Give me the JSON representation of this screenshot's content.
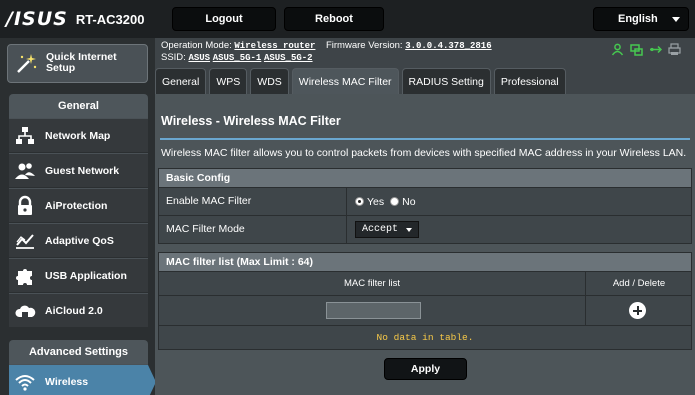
{
  "header": {
    "brand": "/ISUS",
    "model": "RT-AC3200",
    "logout_label": "Logout",
    "reboot_label": "Reboot",
    "language": "English"
  },
  "status": {
    "operation_mode_label": "Operation Mode:",
    "operation_mode_value": "Wireless router",
    "firmware_label": "Firmware Version:",
    "firmware_value": "3.0.0.4.378_2816",
    "ssid_label": "SSID:",
    "ssids": [
      "ASUS",
      "ASUS_5G-1",
      "ASUS_5G-2"
    ]
  },
  "sidebar": {
    "quick_setup": "Quick Internet Setup",
    "general_header": "General",
    "items": [
      {
        "label": "Network Map",
        "icon": "network-map-icon"
      },
      {
        "label": "Guest Network",
        "icon": "guest-network-icon"
      },
      {
        "label": "AiProtection",
        "icon": "lock-icon"
      },
      {
        "label": "Adaptive QoS",
        "icon": "qos-icon"
      },
      {
        "label": "USB Application",
        "icon": "puzzle-icon"
      },
      {
        "label": "AiCloud 2.0",
        "icon": "cloud-icon"
      }
    ],
    "advanced_header": "Advanced Settings",
    "active_item": {
      "label": "Wireless",
      "icon": "wifi-icon"
    }
  },
  "tabs": [
    {
      "label": "General",
      "active": false
    },
    {
      "label": "WPS",
      "active": false
    },
    {
      "label": "WDS",
      "active": false
    },
    {
      "label": "Wireless MAC Filter",
      "active": true
    },
    {
      "label": "RADIUS Setting",
      "active": false
    },
    {
      "label": "Professional",
      "active": false
    }
  ],
  "main": {
    "title": "Wireless - Wireless MAC Filter",
    "description": "Wireless MAC filter allows you to control packets from devices with specified MAC address in your Wireless LAN.",
    "basic_config_header": "Basic Config",
    "enable_label": "Enable MAC Filter",
    "yes_label": "Yes",
    "no_label": "No",
    "enable_value": "Yes",
    "mode_label": "MAC Filter Mode",
    "mode_value": "Accept",
    "list_header": "MAC filter list (Max Limit : 64)",
    "col_list": "MAC filter list",
    "col_action": "Add / Delete",
    "mac_input_value": "",
    "no_data": "No data in table.",
    "apply_label": "Apply"
  },
  "colors": {
    "accent": "#4b83a8",
    "divider": "#6aa7d0",
    "icon_green": "#46c850",
    "no_data_text": "#f7c948"
  }
}
